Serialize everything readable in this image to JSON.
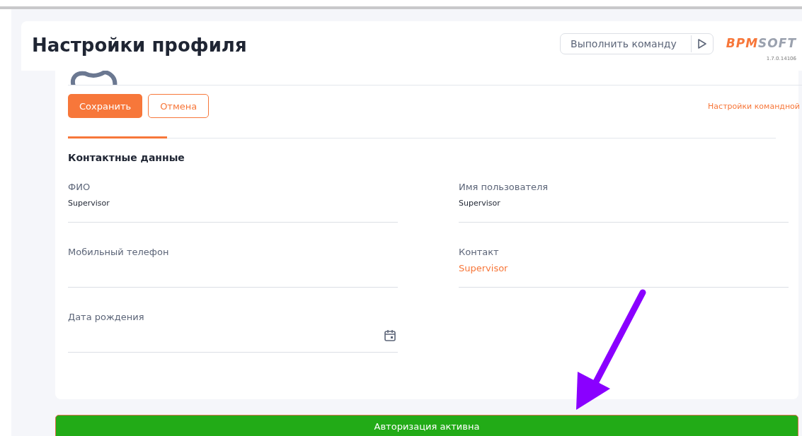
{
  "header": {
    "title": "Настройки профиля",
    "command_placeholder": "Выполнить команду",
    "logo": {
      "part_1": "BPM",
      "part_2": "SOFT"
    },
    "version": "1.7.0.14106"
  },
  "actions": {
    "save": "Сохранить",
    "cancel": "Отмена",
    "link": "Настройки командной"
  },
  "section": {
    "title": "Контактные данные",
    "fields": [
      {
        "label": "ФИО",
        "value": "Supervisor",
        "kind": "text"
      },
      {
        "label": "Имя пользователя",
        "value": "Supervisor",
        "kind": "text"
      },
      {
        "label": "Мобильный телефон",
        "kind": "text"
      },
      {
        "label": "Контакт",
        "value": "Supervisor",
        "kind": "link"
      },
      {
        "label": "Дата рождения",
        "kind": "date"
      }
    ]
  },
  "status_bar": {
    "text": "Авторизация активна"
  }
}
